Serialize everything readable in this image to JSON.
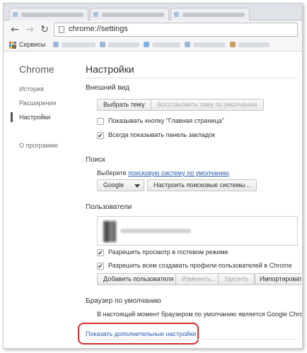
{
  "browser": {
    "url": "chrome://settings",
    "bookmarks_label": "Сервисы"
  },
  "sidebar": {
    "title": "Chrome",
    "items": [
      {
        "label": "История"
      },
      {
        "label": "Расширения"
      },
      {
        "label": "Настройки"
      },
      {
        "label": "О программе"
      }
    ]
  },
  "page": {
    "title": "Настройки"
  },
  "appearance": {
    "title": "Внешний вид",
    "choose_theme": "Выбрать тему",
    "reset_theme": "Восстановить тему по умолчанию",
    "show_home": "Показывать кнопку \"Главная страница\"",
    "show_home_checked": false,
    "show_bookmarks": "Всегда показывать панель закладок",
    "show_bookmarks_checked": true
  },
  "search": {
    "title": "Поиск",
    "prefix": "Выберите ",
    "link": "поисковую систему по умолчанию",
    "suffix": ".",
    "engine": "Google",
    "manage": "Настроить поисковые системы..."
  },
  "users": {
    "title": "Пользователи",
    "guest": "Разрешить просмотр в гостевом режиме",
    "guest_checked": true,
    "profiles": "Разрешить всем создавать профили пользователей в Chrome",
    "profiles_checked": true,
    "add": "Добавить пользователя",
    "edit": "Изменить...",
    "delete": "Удалить",
    "import": "Импортировать"
  },
  "default_browser": {
    "title": "Браузер по умолчанию",
    "status": "В настоящий момент браузером по умолчанию является Google Chrome."
  },
  "advanced_link": "Показать дополнительные настройки",
  "colors": {
    "link": "#2a5db0",
    "highlight": "#d62d2d"
  }
}
